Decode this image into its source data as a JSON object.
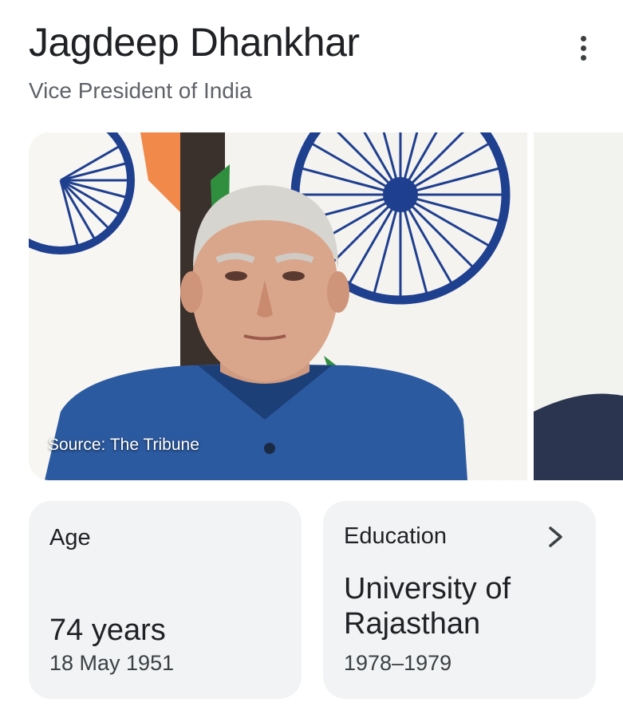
{
  "header": {
    "title": "Jagdeep Dhankhar",
    "subtitle": "Vice President of India",
    "menu_icon": "more-vert-icon"
  },
  "images": {
    "main_source": "Source: The Tribune"
  },
  "colors": {
    "card_background": "#f1f3f4",
    "chakra_blue": "#1f3f8f",
    "saffron": "#f08a3a",
    "green": "#2f8f3f",
    "jacket_blue": "#2c5aa0"
  },
  "facts": {
    "age": {
      "label": "Age",
      "value": "74 years",
      "sub": "18 May 1951"
    },
    "education": {
      "label": "Education",
      "value": "University of Rajasthan",
      "sub": "1978–1979",
      "icon": "chevron-right-icon"
    }
  }
}
